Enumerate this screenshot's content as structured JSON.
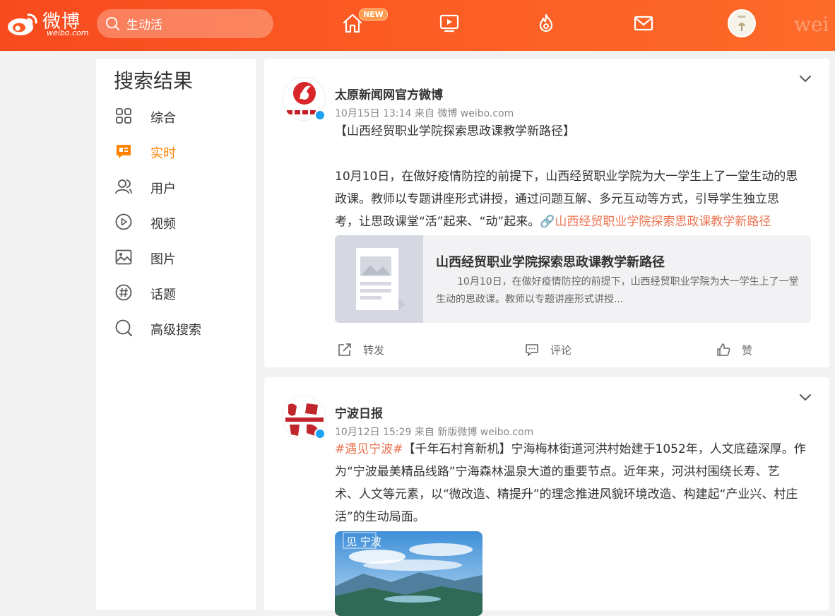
{
  "header": {
    "logo_text": "微博",
    "logo_sub": "weibo.com",
    "search_value": "生动活",
    "new_badge": "NEW",
    "corner_text": "wei"
  },
  "sidebar": {
    "title": "搜索结果",
    "items": [
      {
        "label": "综合",
        "icon": "grid-icon"
      },
      {
        "label": "实时",
        "icon": "realtime-icon",
        "active": true
      },
      {
        "label": "用户",
        "icon": "users-icon"
      },
      {
        "label": "视频",
        "icon": "video-play-icon"
      },
      {
        "label": "图片",
        "icon": "image-icon"
      },
      {
        "label": "话题",
        "icon": "hashtag-icon"
      },
      {
        "label": "高级搜索",
        "icon": "search-icon"
      }
    ]
  },
  "posts": [
    {
      "author": "太原新闻网官方微博",
      "meta": "10月15日 13:14  来自 微博 weibo.com",
      "body_title": "【山西经贸职业学院探索思政课教学新路径】",
      "body_line1": "10月10日，在做好疫情防控的前提下，山西经贸职业学院为大一学生上了一堂生动的思",
      "body_line2": "政课。教师以专题讲座形式讲授，通过问题互解、多元互动等方式，引导学生独立思",
      "body_line3": "考，让思政课堂“活”起来、“动”起来。",
      "link_text": "山西经贸职业学院探索思政课教学新路径",
      "card_title": "山西经贸职业学院探索思政课教学新路径",
      "card_desc": "10月10日，在做好疫情防控的前提下，山西经贸职业学院为大一学生上了一堂生动的思政课。教师以专题讲座形式讲授...",
      "actions": {
        "repost": "转发",
        "comment": "评论",
        "like": "赞"
      }
    },
    {
      "author": "宁波日报",
      "meta": "10月12日 15:29  来自 新版微博 weibo.com",
      "hashtag": "#遇见宁波#",
      "body_line1": "【千年石村育新机】宁海梅林街道河洪村始建于1052年，人文底蕴深厚。作",
      "body_line2": "为“宁波最美精品线路”宁海森林温泉大道的重要节点。近年来，河洪村围绕长寿、艺",
      "body_line3": "术、人文等元素，以“微改造、精提升”的理念推进风貌环境改造、构建起“产业兴、村庄",
      "body_line4": "活”的生动局面。",
      "photo_text": "见 宁波"
    }
  ],
  "colors": {
    "brand": "#fb5b23",
    "accent": "#ff8200",
    "link": "#eb7350",
    "verified": "#1da1f2"
  }
}
